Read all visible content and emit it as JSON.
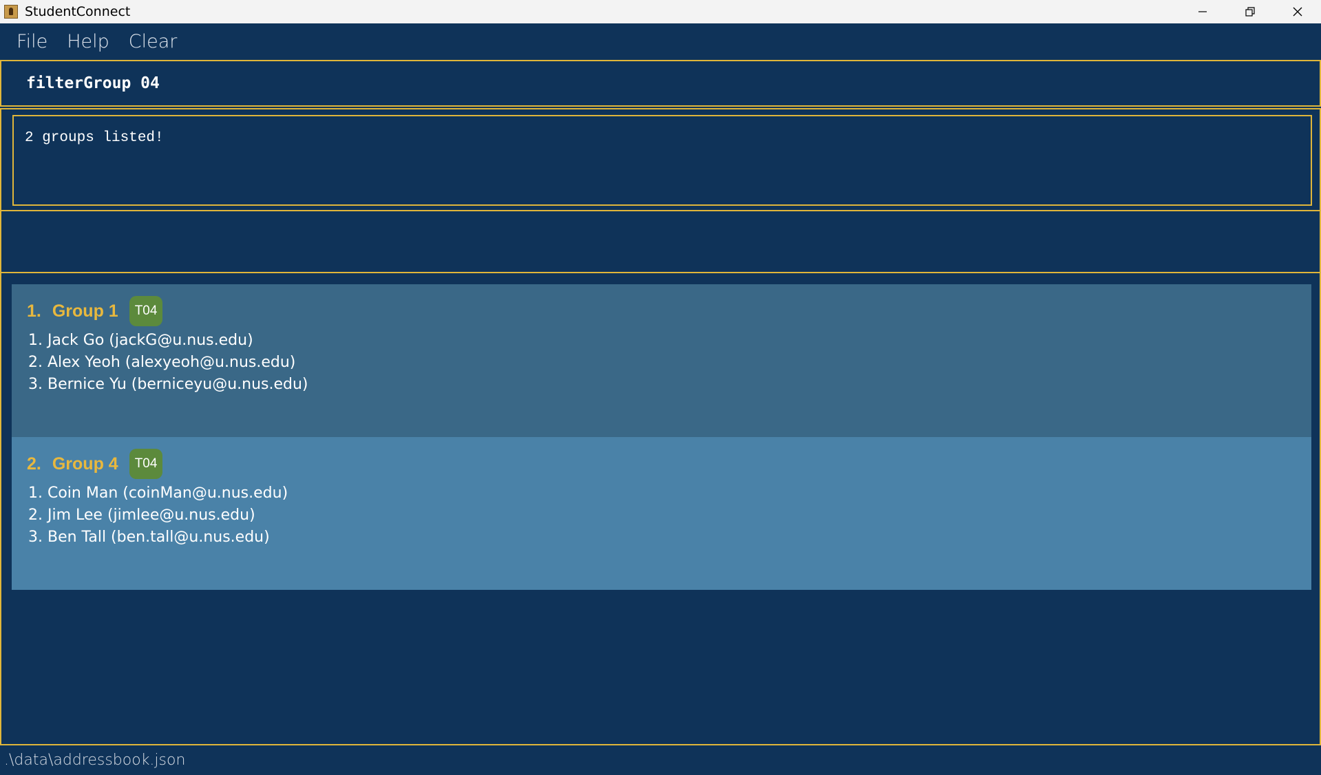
{
  "window": {
    "title": "StudentConnect",
    "icons": [
      "app-icon",
      "minimize-icon",
      "restore-icon",
      "close-icon"
    ]
  },
  "menu": {
    "items": [
      "File",
      "Help",
      "Clear"
    ]
  },
  "command": {
    "value": "filterGroup 04"
  },
  "result": {
    "message": "2 groups listed!"
  },
  "groups": [
    {
      "index": "1.",
      "name": "Group 1",
      "tag": "T04",
      "members": [
        "1. Jack Go (jackG@u.nus.edu)",
        "2. Alex Yeoh (alexyeoh@u.nus.edu)",
        "3. Bernice Yu (berniceyu@u.nus.edu)"
      ]
    },
    {
      "index": "2.",
      "name": "Group 4",
      "tag": "T04",
      "members": [
        "1. Coin Man (coinMan@u.nus.edu)",
        "2. Jim Lee (jimlee@u.nus.edu)",
        "3. Ben Tall (ben.tall@u.nus.edu)"
      ]
    }
  ],
  "status": {
    "path": ".\\data\\addressbook.json"
  },
  "colors": {
    "background": "#0f3359",
    "border": "#e0b63a",
    "card_odd": "#3a6887",
    "card_even": "#4a82a8",
    "group_title": "#e8b83e",
    "tag": "#5c8a3c"
  }
}
